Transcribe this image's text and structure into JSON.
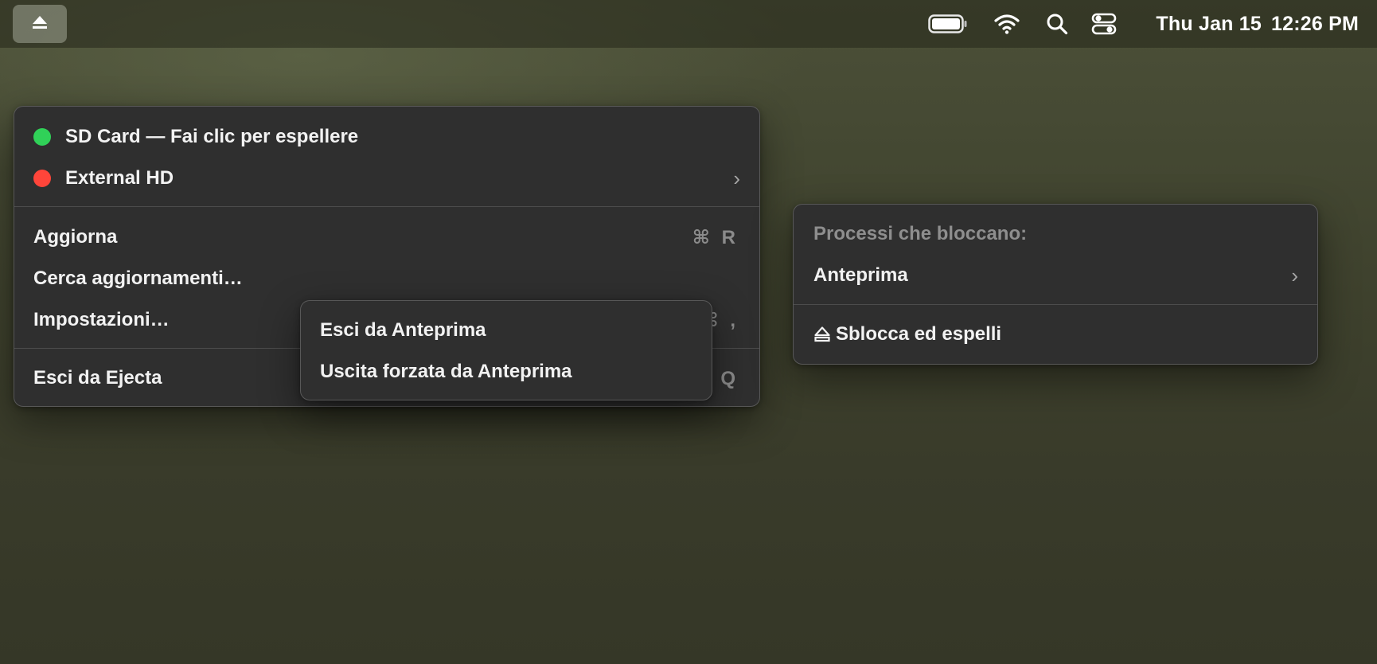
{
  "menubar": {
    "status_icon": "eject-icon",
    "icons": [
      "battery-icon",
      "wifi-icon",
      "search-icon",
      "control-center-icon"
    ],
    "date": "Thu Jan 15",
    "time": "12:26 PM"
  },
  "main_menu": {
    "drives": [
      {
        "label": "SD Card — Fai clic per espellere",
        "status_color": "#30d158"
      },
      {
        "label": "External HD",
        "status_color": "#ff453a",
        "submenu": "chevron-right-icon"
      }
    ],
    "items": [
      {
        "label": "Aggiorna",
        "shortcut": "⌘ R"
      },
      {
        "label": "Cerca aggiornamenti…",
        "shortcut": ""
      },
      {
        "label": "Impostazioni…",
        "shortcut": "⌘ ,"
      },
      {
        "label": "Esci da Ejecta",
        "shortcut": "⌘ Q"
      }
    ]
  },
  "external_hd_submenu": {
    "heading": "Processi che bloccano:",
    "process": "Anteprima",
    "action_icon": "eject-icon",
    "action": "Sblocca ed espelli"
  },
  "process_submenu": {
    "items": [
      "Esci da Anteprima",
      "Uscita forzata da Anteprima"
    ]
  },
  "colors": {
    "menu_bg": "#2f2f2f",
    "text": "#f2f2f2",
    "shortcut_text": "#8b8b8b",
    "green": "#30d158",
    "red": "#ff453a"
  }
}
